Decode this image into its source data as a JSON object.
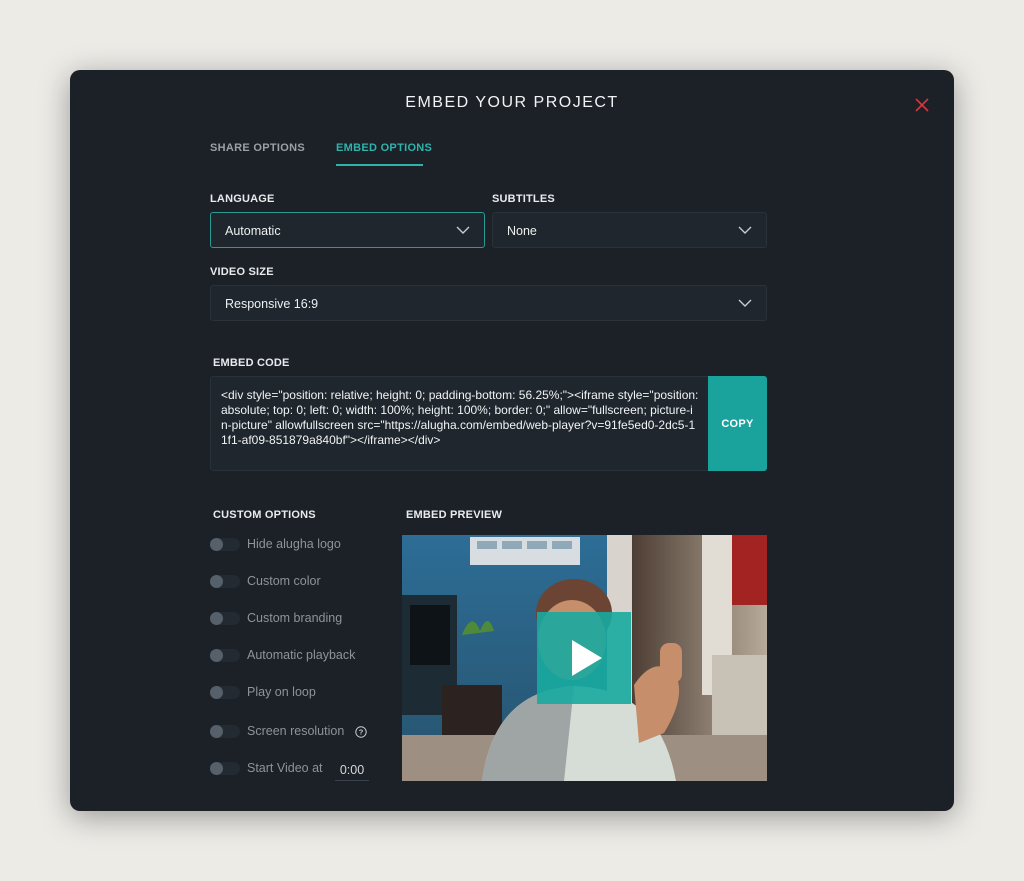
{
  "modal": {
    "title": "EMBED YOUR PROJECT",
    "close_icon": "close-x-icon",
    "accent_color": "#2fb3ac",
    "close_color": "#d9363e"
  },
  "tabs": [
    {
      "label": "SHARE OPTIONS",
      "active": false
    },
    {
      "label": "EMBED OPTIONS",
      "active": true
    }
  ],
  "language": {
    "label": "LANGUAGE",
    "value": "Automatic"
  },
  "subtitles": {
    "label": "SUBTITLES",
    "value": "None"
  },
  "video_size": {
    "label": "VIDEO SIZE",
    "value": "Responsive 16:9"
  },
  "embed_code": {
    "label": "EMBED CODE",
    "code": "<div style=\"position: relative; height: 0; padding-bottom: 56.25%;\"><iframe style=\"position: absolute; top: 0; left: 0; width: 100%; height: 100%; border: 0;\" allow=\"fullscreen; picture-in-picture\" allowfullscreen src=\"https://alugha.com/embed/web-player?v=91fe5ed0-2dc5-11f1-af09-851879a840bf\"></iframe></div>",
    "copy_label": "COPY"
  },
  "custom_options": {
    "label": "CUSTOM OPTIONS",
    "items": [
      {
        "label": "Hide alugha logo",
        "enabled": false
      },
      {
        "label": "Custom color",
        "enabled": false
      },
      {
        "label": "Custom branding",
        "enabled": false
      },
      {
        "label": "Automatic playback",
        "enabled": false
      },
      {
        "label": "Play on loop",
        "enabled": false
      },
      {
        "label": "Screen resolution",
        "enabled": false,
        "icon": "help-circle-icon"
      },
      {
        "label": "Start Video at",
        "enabled": false,
        "time": "0:00"
      }
    ]
  },
  "embed_preview": {
    "label": "EMBED PREVIEW",
    "play_icon": "play-icon"
  }
}
